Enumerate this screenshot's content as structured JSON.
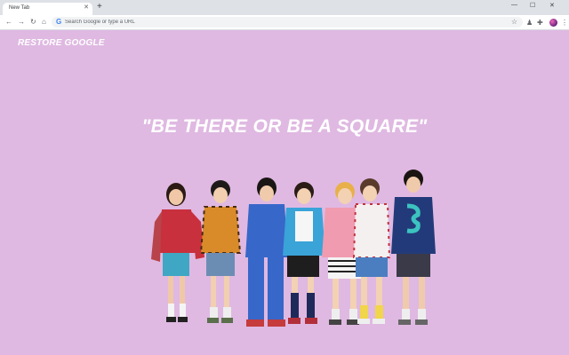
{
  "browser": {
    "tab": {
      "title": "New Tab",
      "close_icon": "close-icon"
    },
    "new_tab_icon": "plus-icon",
    "omnibox": {
      "placeholder": "Search Google or type a URL"
    },
    "icons": [
      "back-arrow-icon",
      "forward-arrow-icon",
      "reload-icon",
      "star-icon",
      "puzzle-extension-icon",
      "kebab-menu-icon"
    ]
  },
  "page": {
    "restore_label": "RESTORE GOOGLE",
    "quote": "\"BE THERE OR BE A SQUARE\"",
    "background_color": "#dfb9e2",
    "image_description_note": "group-photo-seven-members"
  },
  "colors": {
    "accent_text": "#ffffff",
    "tabstrip": "#dee1e6"
  }
}
